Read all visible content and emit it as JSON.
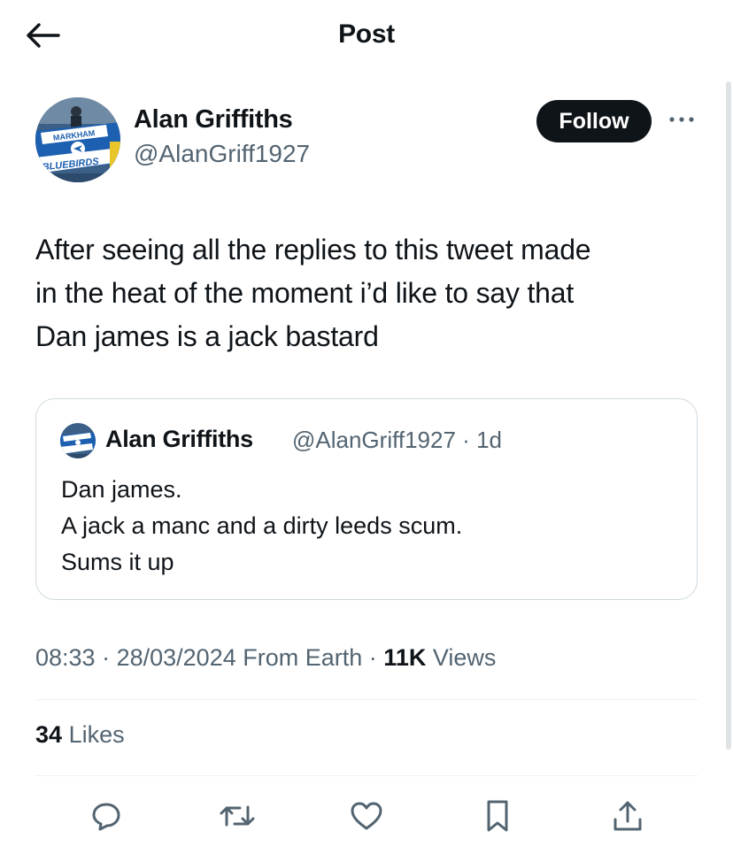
{
  "header": {
    "title": "Post",
    "back_icon": "arrow-left-icon"
  },
  "post": {
    "author": {
      "name": "Alan Griffiths",
      "handle": "@AlanGriff1927",
      "avatar_banner_top": "MARKHAM",
      "avatar_banner_bottom": "BLUEBIRDS"
    },
    "follow_label": "Follow",
    "more_icon": "more-horizontal-icon",
    "text": "After seeing all the replies to this tweet made\nin the heat of the moment i’d like to say that\nDan james is a jack bastard",
    "quoted": {
      "name": "Alan Griffiths",
      "handle": "@AlanGriff1927",
      "separator": "·",
      "age": "1d",
      "text": "Dan james.\nA jack a manc and a dirty leeds scum.\nSums it up"
    },
    "time": "08:33",
    "date": "28/03/2024",
    "source": "From Earth",
    "views_count": "11K",
    "views_label": "Views",
    "likes_count": "34",
    "likes_label": "Likes"
  },
  "actions": [
    {
      "icon": "reply-icon"
    },
    {
      "icon": "repost-icon"
    },
    {
      "icon": "like-icon"
    },
    {
      "icon": "bookmark-icon"
    },
    {
      "icon": "share-icon"
    }
  ],
  "colors": {
    "text_primary": "#0f1419",
    "text_secondary": "#536471",
    "follow_bg": "#0f1419",
    "border": "#cfd9de",
    "avatar_blue": "#1d5fb0"
  }
}
